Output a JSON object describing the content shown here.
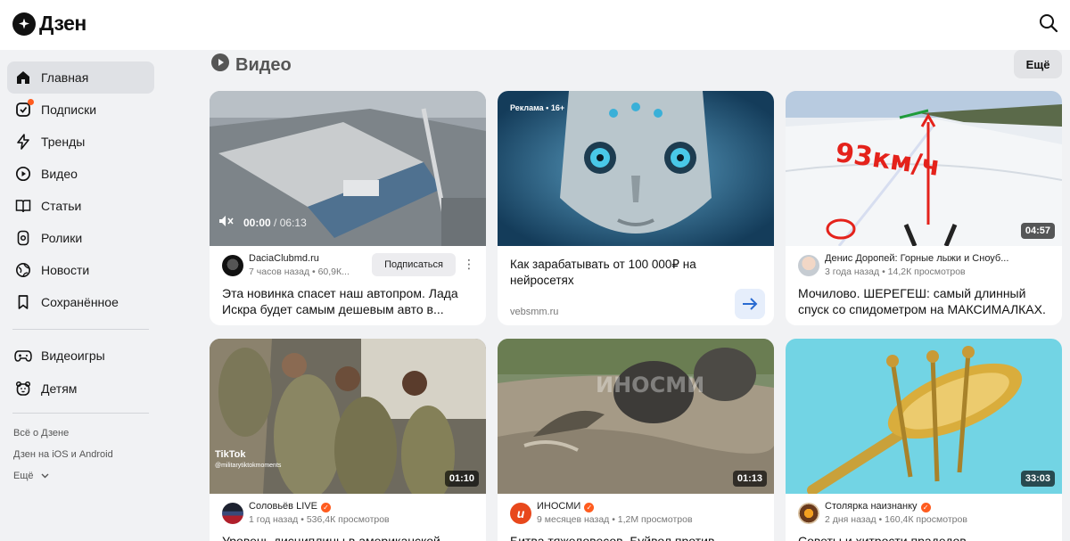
{
  "header": {
    "logo_text": "Дзен"
  },
  "sidebar": {
    "items": [
      {
        "label": "Главная",
        "icon": "home-icon",
        "active": true
      },
      {
        "label": "Подписки",
        "icon": "subscriptions-icon",
        "badge": true
      },
      {
        "label": "Тренды",
        "icon": "lightning-icon"
      },
      {
        "label": "Видео",
        "icon": "video-play-icon"
      },
      {
        "label": "Статьи",
        "icon": "book-icon"
      },
      {
        "label": "Ролики",
        "icon": "shorts-icon"
      },
      {
        "label": "Новости",
        "icon": "globe-icon"
      },
      {
        "label": "Сохранённое",
        "icon": "bookmark-icon"
      }
    ],
    "extra": [
      {
        "label": "Видеоигры",
        "icon": "gamepad-icon"
      },
      {
        "label": "Детям",
        "icon": "bear-icon"
      }
    ],
    "footer": {
      "about": "Всё о Дзене",
      "apps": "Дзен на iOS и Android",
      "more": "Ещё"
    }
  },
  "section": {
    "title": "Видео",
    "more_label": "Ещё"
  },
  "cards": [
    {
      "channel": "DaciaClubmd.ru",
      "sub": "7 часов назад • 60,9К...",
      "subscribe": "Подписаться",
      "title": "Эта новинка спасет наш автопром. Лада Искра будет самым дешевым авто в...",
      "time_current": "00:00",
      "time_total": "/ 06:13"
    },
    {
      "ad_badge": "Реклама • 16+",
      "ad_title": "Как зарабатывать от 100 000₽ на нейросетях",
      "ad_domain": "vebsmm.ru"
    },
    {
      "channel": "Денис Доропей: Горные лыжи и Сноуб...",
      "sub": "3 года назад • 14,2К просмотров",
      "title": "Мочилово. ШЕРЕГЕШ: самый длинный спуск со спидометром на МАКСИМАЛКАХ.",
      "duration": "04:57",
      "overlay": "93км/ч"
    },
    {
      "channel": "Соловьёв LIVE",
      "sub": "1 год назад • 536,4К просмотров",
      "title": "Уровень дисциплины в американской",
      "duration": "01:10",
      "tiktok": "TikTok",
      "tiktok_user": "@militarytiktokmoments"
    },
    {
      "channel": "ИНОСМИ",
      "sub": "9 месяцев назад • 1,2М просмотров",
      "title": "Битва тяжеловесов. Буйвол против",
      "duration": "01:13",
      "watermark": "ИНОСМИ"
    },
    {
      "channel": "Столярка наизнанку",
      "sub": "2 дня назад • 160,4К просмотров",
      "title": "Советы и хитрости прадедов",
      "duration": "33:03"
    }
  ]
}
